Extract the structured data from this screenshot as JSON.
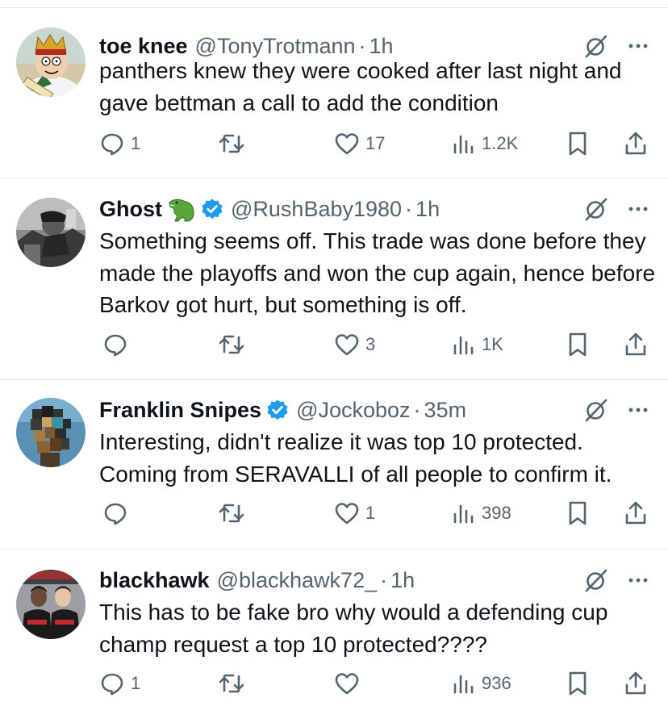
{
  "tweets": [
    {
      "display_name": "toe knee",
      "handle": "@TonyTrotmann",
      "dot": "·",
      "time": "1h",
      "verified": false,
      "text": "panthers knew they were cooked after last night and gave bettman a call to add the condition",
      "reply_count": "1",
      "repost_count": "",
      "like_count": "17",
      "view_count": "1.2K",
      "avatar_icon": "family-guy-king-avatar"
    },
    {
      "display_name": "Ghost",
      "handle": "@RushBaby1980",
      "dot": "·",
      "time": "1h",
      "verified": true,
      "emoji": "crocodile-emoji",
      "text": "Something seems off. This trade was done before they made the playoffs and won the cup again, hence before Barkov got hurt, but something is off.",
      "reply_count": "",
      "repost_count": "",
      "like_count": "3",
      "view_count": "1K",
      "avatar_icon": "bw-photo-avatar"
    },
    {
      "display_name": "Franklin Snipes",
      "handle": "@Jockoboz",
      "dot": "·",
      "time": "35m",
      "verified": true,
      "text": "Interesting, didn't realize it was top 10 protected. Coming from SERAVALLI of all people to confirm it.",
      "reply_count": "",
      "repost_count": "",
      "like_count": "1",
      "view_count": "398",
      "avatar_icon": "pixelated-dog-avatar"
    },
    {
      "display_name": "blackhawk",
      "handle": "@blackhawk72_",
      "dot": "·",
      "time": "1h",
      "verified": false,
      "text": "This has to be fake bro why would a defending cup champ request a top 10 protected????",
      "reply_count": "1",
      "repost_count": "",
      "like_count": "",
      "view_count": "936",
      "avatar_icon": "hockey-players-avatar"
    }
  ],
  "colors": {
    "text": "#0f1419",
    "muted": "#536471",
    "verified": "#1d9bf0",
    "divider": "#e6e8ea"
  }
}
